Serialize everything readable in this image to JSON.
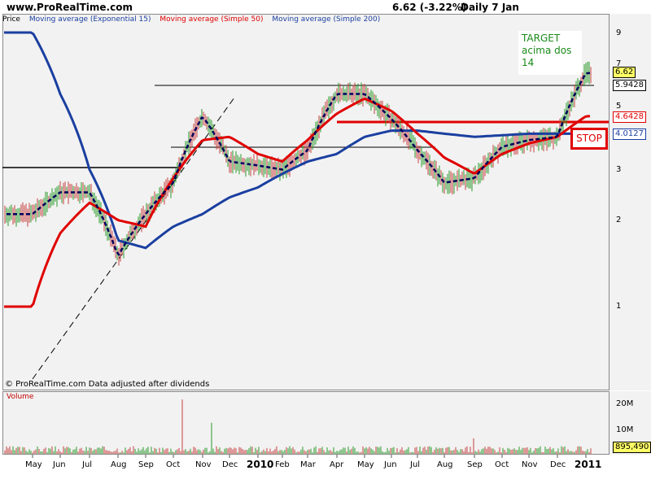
{
  "header": {
    "site": "www.ProRealTime.com",
    "quote": "6.62 (-3.22%)",
    "period": "Daily  7 Jan"
  },
  "legend": {
    "price": "Price",
    "ema15": "Moving average (Exponential 15)",
    "sma50": "Moving average (Simple 50)",
    "sma200": "Moving average (Simple 200)"
  },
  "colors": {
    "ema15": "#00005a",
    "sma50": "#e00000",
    "sma200": "#1a3fa0",
    "candle_up": "#2a9a2a",
    "candle_down": "#c84040",
    "annotation": "#e00000",
    "target_text": "#1a8a1a"
  },
  "annotations": {
    "target_lines": [
      "TARGET",
      "acima dos",
      "14"
    ],
    "stop": "STOP",
    "footer": "© ProRealTime.com  Data adjusted after dividends",
    "volume_label": "Volume"
  },
  "price_boxes": {
    "last": "6.62",
    "resistance": "5.9428",
    "sma50": "4.6428",
    "sma200": "4.0127",
    "volume": "895,490"
  },
  "axes": {
    "y_ticks": [
      "9",
      "7",
      "5",
      "3",
      "2",
      "1"
    ],
    "vol_ticks": [
      "20M",
      "10M"
    ],
    "months": [
      "May",
      "Jun",
      "Jul",
      "Aug",
      "Sep",
      "Oct",
      "Nov",
      "Dec",
      "2010",
      "Feb",
      "Mar",
      "Apr",
      "May",
      "Jun",
      "Jul",
      "Aug",
      "Sep",
      "Oct",
      "Nov",
      "Dec",
      "2011"
    ]
  },
  "chart_data": {
    "type": "line",
    "scale": "log",
    "ylim": [
      0.6,
      10
    ],
    "x": [
      "May",
      "Jun",
      "Jul",
      "Aug",
      "Sep",
      "Oct",
      "Nov",
      "Dec",
      "2010",
      "Feb",
      "Mar",
      "Apr",
      "May",
      "Jun",
      "Jul",
      "Aug",
      "Sep",
      "Oct",
      "Nov",
      "Dec",
      "2011"
    ],
    "series": [
      {
        "name": "Moving average (Exponential 15)",
        "values": [
          2.1,
          2.5,
          2.5,
          1.5,
          2.1,
          2.7,
          4.6,
          3.2,
          3.1,
          3.0,
          3.5,
          5.5,
          5.5,
          4.5,
          3.5,
          2.7,
          2.8,
          3.6,
          3.8,
          3.9,
          6.5
        ]
      },
      {
        "name": "Moving average (Simple 50)",
        "values": [
          1.0,
          1.8,
          2.3,
          2.0,
          1.9,
          2.8,
          3.8,
          3.9,
          3.4,
          3.2,
          3.8,
          4.7,
          5.3,
          4.8,
          4.0,
          3.3,
          2.9,
          3.4,
          3.7,
          3.9,
          4.6
        ]
      },
      {
        "name": "Moving average (Simple 200)",
        "values": [
          9.0,
          5.5,
          3.0,
          1.7,
          1.6,
          1.9,
          2.1,
          2.4,
          2.6,
          2.9,
          3.2,
          3.4,
          3.9,
          4.1,
          4.1,
          4.0,
          3.9,
          3.95,
          4.0,
          4.0,
          4.0
        ]
      }
    ],
    "reference_lines": [
      5.9428,
      4.6428,
      4.0127
    ],
    "last_price": 6.62,
    "volume_max_m": 22
  }
}
